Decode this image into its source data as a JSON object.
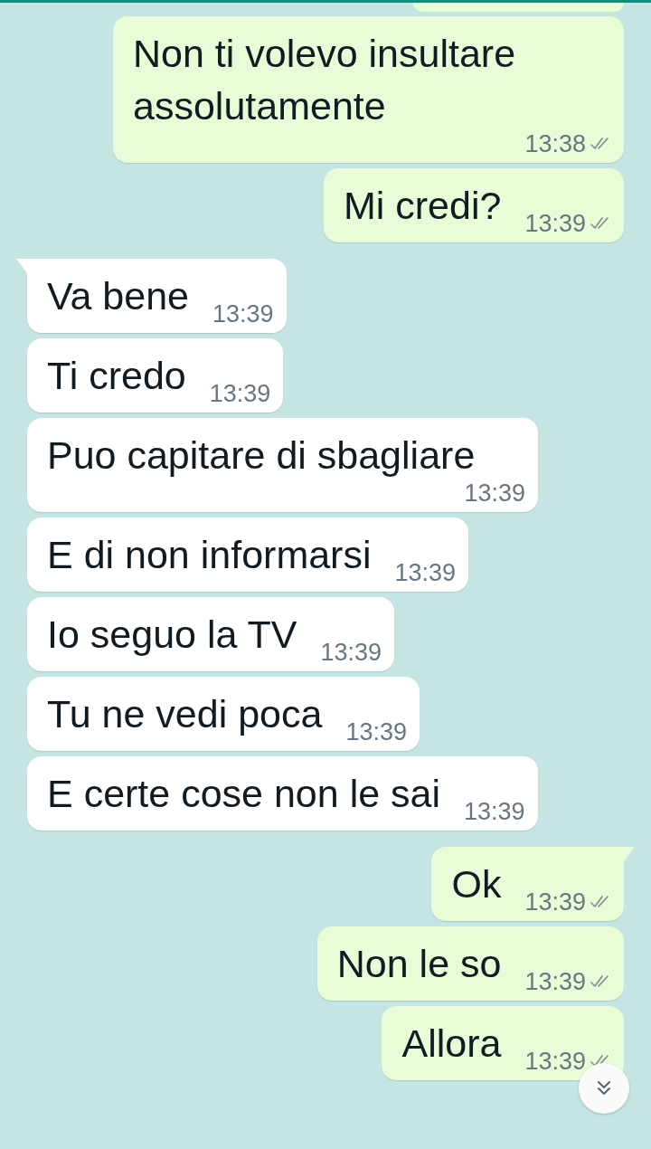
{
  "messages": [
    {
      "kind": "outgoing",
      "tail": false,
      "text": "Non ti volevo insultare assolutamente",
      "time": "13:38",
      "read": false
    },
    {
      "kind": "outgoing",
      "tail": false,
      "text": "Mi credi?",
      "time": "13:39",
      "read": false
    },
    {
      "kind": "incoming",
      "tail": true,
      "text": "Va bene",
      "time": "13:39"
    },
    {
      "kind": "incoming",
      "tail": false,
      "text": "Ti credo",
      "time": "13:39"
    },
    {
      "kind": "incoming",
      "tail": false,
      "text": "Puo capitare di sbagliare",
      "time": "13:39"
    },
    {
      "kind": "incoming",
      "tail": false,
      "text": "E di non informarsi",
      "time": "13:39"
    },
    {
      "kind": "incoming",
      "tail": false,
      "text": "Io seguo la TV",
      "time": "13:39"
    },
    {
      "kind": "incoming",
      "tail": false,
      "text": "Tu ne vedi poca",
      "time": "13:39"
    },
    {
      "kind": "incoming",
      "tail": false,
      "text": "E certe cose non le sai",
      "time": "13:39"
    },
    {
      "kind": "outgoing",
      "tail": true,
      "text": "Ok",
      "time": "13:39",
      "read": false
    },
    {
      "kind": "outgoing",
      "tail": false,
      "text": "Non le so",
      "time": "13:39",
      "read": false
    },
    {
      "kind": "outgoing",
      "tail": false,
      "text": "Allora",
      "time": "13:39",
      "read": false
    }
  ]
}
